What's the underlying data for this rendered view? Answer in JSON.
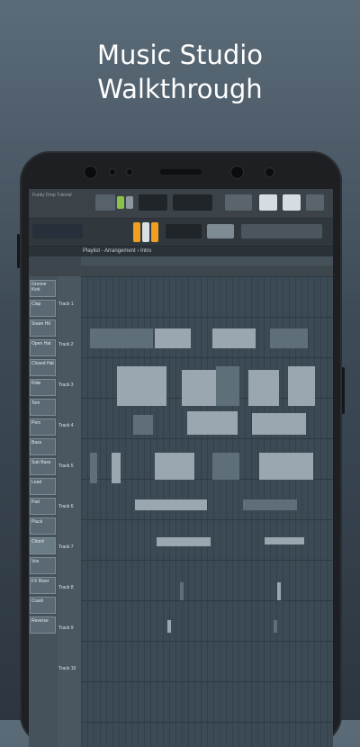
{
  "headline": {
    "line1": "Music Studio",
    "line2": "Walkthrough"
  },
  "daw": {
    "song_title": "Funky Drop Tutorial",
    "playlist_title": "Playlist - Arrangement › Intro",
    "channels": [
      "Groove Kick",
      "Clap",
      "Snare Hit",
      "Open Hat",
      "Closed Hat",
      "Ride",
      "Tom",
      "Perc",
      "Bass",
      "Sub Bass",
      "Lead",
      "Pad",
      "Pluck",
      "Chord",
      "Vox",
      "FX Riser",
      "Crash",
      "Reverse"
    ],
    "tracks": [
      "Track 1",
      "Track 2",
      "Track 3",
      "Track 4",
      "Track 5",
      "Track 6",
      "Track 7",
      "Track 8",
      "Track 9",
      "Track 10"
    ]
  },
  "colors": {
    "accent": "#f0a020",
    "bg_top": "#5b6b78",
    "bg_bottom": "#2c3640"
  }
}
